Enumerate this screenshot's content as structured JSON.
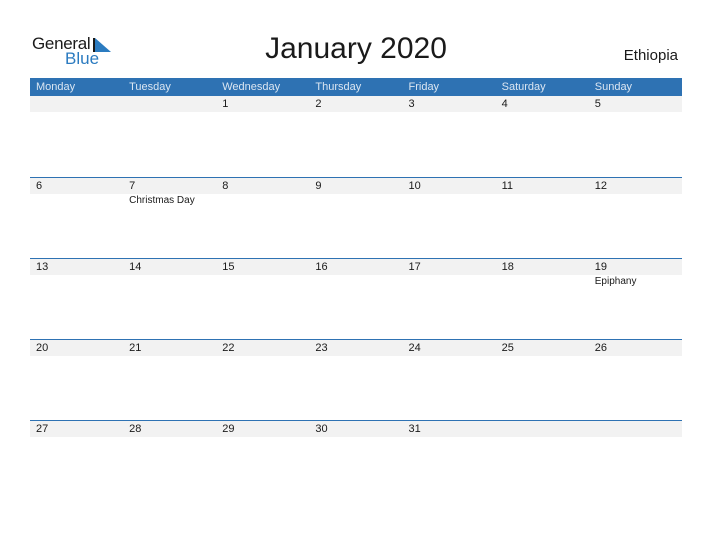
{
  "logo": {
    "line1": "General",
    "line2": "Blue"
  },
  "title": "January 2020",
  "country": "Ethiopia",
  "weekdays": [
    "Monday",
    "Tuesday",
    "Wednesday",
    "Thursday",
    "Friday",
    "Saturday",
    "Sunday"
  ],
  "weeks": [
    {
      "days": [
        "",
        "",
        "1",
        "2",
        "3",
        "4",
        "5"
      ],
      "events": [
        "",
        "",
        "",
        "",
        "",
        "",
        ""
      ]
    },
    {
      "days": [
        "6",
        "7",
        "8",
        "9",
        "10",
        "11",
        "12"
      ],
      "events": [
        "",
        "Christmas Day",
        "",
        "",
        "",
        "",
        ""
      ]
    },
    {
      "days": [
        "13",
        "14",
        "15",
        "16",
        "17",
        "18",
        "19"
      ],
      "events": [
        "",
        "",
        "",
        "",
        "",
        "",
        "Epiphany"
      ]
    },
    {
      "days": [
        "20",
        "21",
        "22",
        "23",
        "24",
        "25",
        "26"
      ],
      "events": [
        "",
        "",
        "",
        "",
        "",
        "",
        ""
      ]
    },
    {
      "days": [
        "27",
        "28",
        "29",
        "30",
        "31",
        "",
        ""
      ],
      "events": [
        "",
        "",
        "",
        "",
        "",
        "",
        ""
      ]
    }
  ],
  "colors": {
    "header": "#2e72b3",
    "brand_blue": "#2b7bc0",
    "date_row": "#f2f2f2"
  }
}
